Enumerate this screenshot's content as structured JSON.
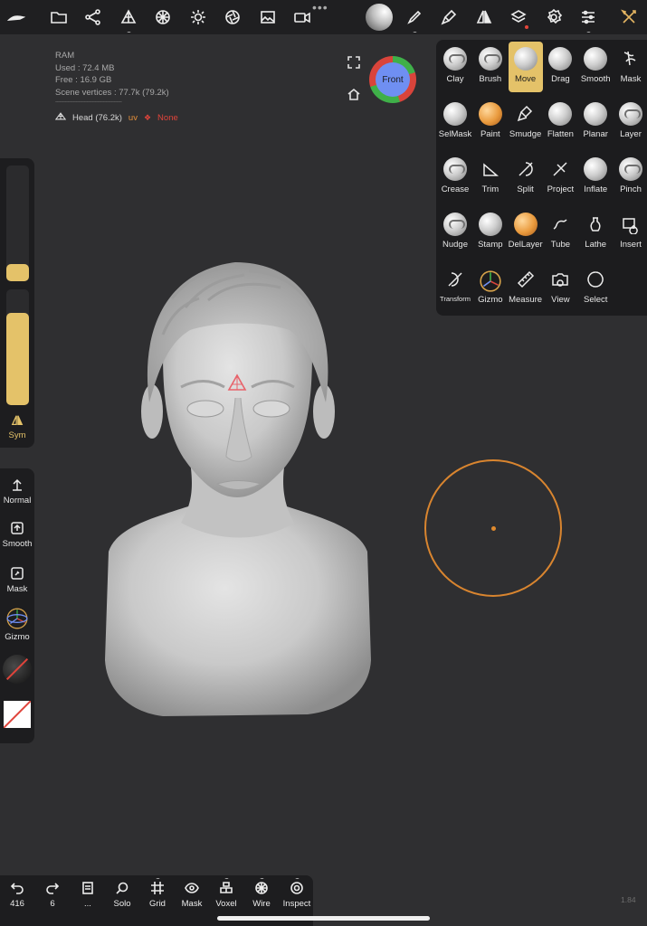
{
  "topbar": {
    "more_dots": "•••",
    "icons": [
      "nomad-logo-icon",
      "folder-icon",
      "scene-graph-icon",
      "topology-icon",
      "sphere-icon",
      "light-icon",
      "aperture-icon",
      "image-icon",
      "camera-icon",
      "matcap-icon",
      "brush-icon",
      "paint-brush-icon",
      "symmetry-icon",
      "layers-icon",
      "settings-icon",
      "sliders-icon",
      "tools-icon"
    ],
    "sub_dots": "..."
  },
  "stats": {
    "ram": "RAM",
    "used": "Used : 72.4 MB",
    "free": "Free : 16.9 GB",
    "vertices": "Scene vertices : 77.7k (79.2k)",
    "separator": "-------------------------------------------------"
  },
  "mesh": {
    "name": "Head (76.2k)",
    "uv": "uv",
    "none": "None"
  },
  "view_cube": {
    "label": "Front"
  },
  "left": {
    "radius_fraction": 0.15,
    "intensity_fraction": 0.8,
    "sym": "Sym",
    "normal": "Normal",
    "smooth": "Smooth",
    "mask": "Mask",
    "gizmo": "Gizmo"
  },
  "tools": [
    {
      "label": "Clay",
      "icon": "clay-icon"
    },
    {
      "label": "Brush",
      "icon": "brush-tool-icon"
    },
    {
      "label": "Move",
      "icon": "move-icon",
      "active": true
    },
    {
      "label": "Drag",
      "icon": "drag-icon"
    },
    {
      "label": "Smooth",
      "icon": "smooth-icon"
    },
    {
      "label": "Mask",
      "icon": "mask-icon"
    },
    {
      "label": "SelMask",
      "icon": "selmask-icon"
    },
    {
      "label": "Paint",
      "icon": "paint-icon"
    },
    {
      "label": "Smudge",
      "icon": "smudge-icon"
    },
    {
      "label": "Flatten",
      "icon": "flatten-icon"
    },
    {
      "label": "Planar",
      "icon": "planar-icon"
    },
    {
      "label": "Layer",
      "icon": "layer-icon"
    },
    {
      "label": "Crease",
      "icon": "crease-icon"
    },
    {
      "label": "Trim",
      "icon": "trim-icon"
    },
    {
      "label": "Split",
      "icon": "split-icon"
    },
    {
      "label": "Project",
      "icon": "project-icon"
    },
    {
      "label": "Inflate",
      "icon": "inflate-icon"
    },
    {
      "label": "Pinch",
      "icon": "pinch-icon"
    },
    {
      "label": "Nudge",
      "icon": "nudge-icon"
    },
    {
      "label": "Stamp",
      "icon": "stamp-icon"
    },
    {
      "label": "DelLayer",
      "icon": "dellayer-icon"
    },
    {
      "label": "Tube",
      "icon": "tube-icon"
    },
    {
      "label": "Lathe",
      "icon": "lathe-icon"
    },
    {
      "label": "Insert",
      "icon": "insert-icon"
    },
    {
      "label": "Transform",
      "icon": "transform-icon"
    },
    {
      "label": "Gizmo",
      "icon": "gizmo-icon"
    },
    {
      "label": "Measure",
      "icon": "measure-icon"
    },
    {
      "label": "View",
      "icon": "view-camera-icon"
    },
    {
      "label": "Select",
      "icon": "select-icon"
    }
  ],
  "bottom": {
    "undo": "416",
    "redo": "6",
    "more": "...",
    "solo": "Solo",
    "grid": "Grid",
    "mask": "Mask",
    "voxel": "Voxel",
    "wire": "Wire",
    "inspect": "Inspect"
  },
  "version": "1.84",
  "colors": {
    "accent": "#e4c269",
    "brush_ring": "#d9852f",
    "uv": "#e6903a",
    "none": "#e0443b"
  }
}
